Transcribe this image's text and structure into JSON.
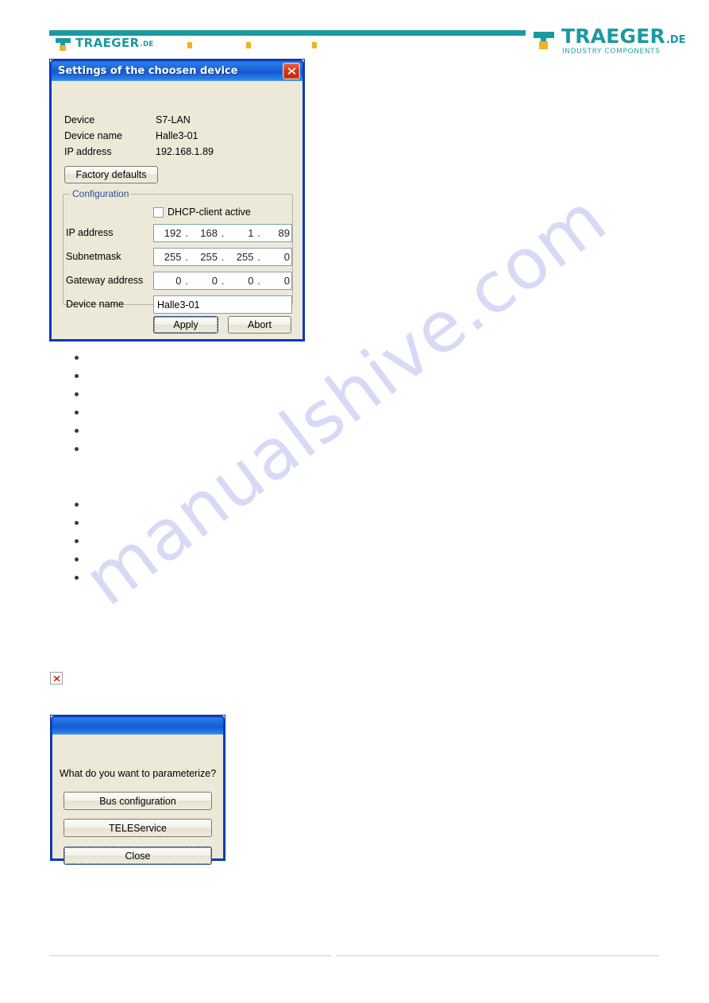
{
  "header": {
    "logo_left": {
      "word": "TRAEGER",
      "tld": ".DE",
      "icon": "traeger-logo-mark"
    },
    "logo_right": {
      "word": "TRAEGER",
      "tld": ".DE",
      "subtitle": "INDUSTRY COMPONENTS",
      "icon": "traeger-logo-mark"
    },
    "accent_color": "#1a9aa0",
    "dot_color": "#f0b323"
  },
  "watermark": {
    "text": "manualshive.com",
    "color": "#c9cdf0"
  },
  "settings_dialog": {
    "title": "Settings of the choosen device",
    "close_icon": "close-icon",
    "info": [
      {
        "label": "Device",
        "value": "S7-LAN"
      },
      {
        "label": "Device name",
        "value": "Halle3-01"
      },
      {
        "label": "IP address",
        "value": "192.168.1.89"
      }
    ],
    "factory_defaults_label": "Factory defaults",
    "configuration": {
      "legend": "Configuration",
      "dhcp": {
        "label": "DHCP-client active",
        "checked": false
      },
      "ip_address": {
        "label": "IP address",
        "octets": [
          "192",
          "168",
          "1",
          "89"
        ]
      },
      "subnetmask": {
        "label": "Subnetmask",
        "octets": [
          "255",
          "255",
          "255",
          "0"
        ]
      },
      "gateway_address": {
        "label": "Gateway address",
        "octets": [
          "0",
          "0",
          "0",
          "0"
        ]
      },
      "device_name": {
        "label": "Device name",
        "value": "Halle3-01"
      }
    },
    "apply_label": "Apply",
    "abort_label": "Abort"
  },
  "bullets_group_1": [
    "",
    "",
    "",
    "",
    "",
    ""
  ],
  "bullets_group_2": [
    "",
    "",
    "",
    "",
    ""
  ],
  "broken_image": {
    "icon": "broken-image-icon"
  },
  "parameterize_dialog": {
    "title": "",
    "question": "What do you want to parameterize?",
    "buttons": [
      {
        "label": "Bus configuration"
      },
      {
        "label": "TELEService"
      },
      {
        "label": "Close"
      }
    ]
  }
}
